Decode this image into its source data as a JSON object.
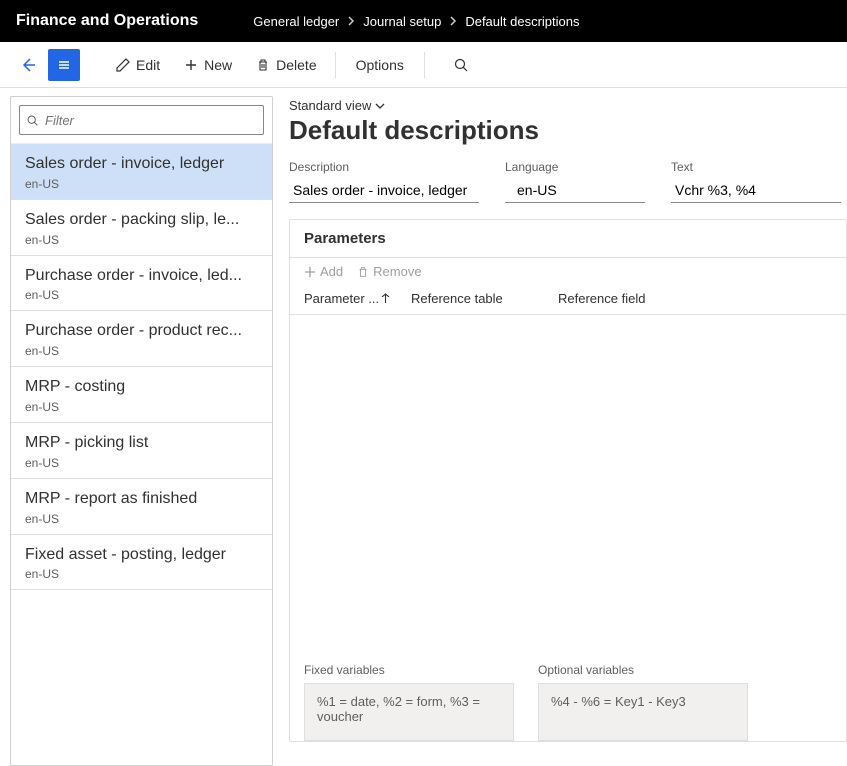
{
  "app_title": "Finance and Operations",
  "breadcrumb": {
    "items": [
      "General ledger",
      "Journal setup",
      "Default descriptions"
    ]
  },
  "action_bar": {
    "edit_label": "Edit",
    "new_label": "New",
    "delete_label": "Delete",
    "options_label": "Options"
  },
  "filter": {
    "placeholder": "Filter"
  },
  "list": {
    "items": [
      {
        "title": "Sales order - invoice, ledger",
        "lang": "en-US",
        "selected": true
      },
      {
        "title": "Sales order - packing slip, le...",
        "lang": "en-US",
        "selected": false
      },
      {
        "title": "Purchase order - invoice, led...",
        "lang": "en-US",
        "selected": false
      },
      {
        "title": "Purchase order - product rec...",
        "lang": "en-US",
        "selected": false
      },
      {
        "title": "MRP - costing",
        "lang": "en-US",
        "selected": false
      },
      {
        "title": "MRP - picking list",
        "lang": "en-US",
        "selected": false
      },
      {
        "title": "MRP - report as finished",
        "lang": "en-US",
        "selected": false
      },
      {
        "title": "Fixed asset - posting, ledger",
        "lang": "en-US",
        "selected": false
      }
    ]
  },
  "detail": {
    "view_label": "Standard view",
    "page_title": "Default descriptions",
    "fields": {
      "description_label": "Description",
      "description_value": "Sales order - invoice, ledger",
      "language_label": "Language",
      "language_value": "en-US",
      "text_label": "Text",
      "text_value": "Vchr %3, %4"
    },
    "parameters": {
      "header": "Parameters",
      "add_label": "Add",
      "remove_label": "Remove",
      "col_parameter": "Parameter ...",
      "col_ref_table": "Reference table",
      "col_ref_field": "Reference field"
    },
    "variables": {
      "fixed_label": "Fixed variables",
      "fixed_text": "%1 = date, %2 = form, %3 = voucher",
      "optional_label": "Optional variables",
      "optional_text": "%4 - %6 = Key1 - Key3"
    }
  }
}
